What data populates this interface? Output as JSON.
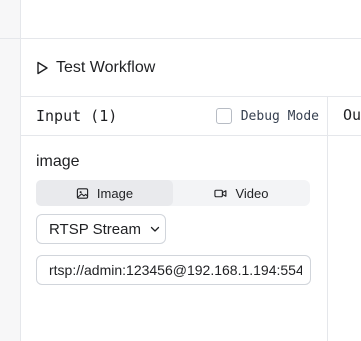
{
  "header": {
    "test_workflow_label": "Test Workflow"
  },
  "input_panel": {
    "title": "Input (1)",
    "debug_mode_label": "Debug Mode",
    "debug_mode_checked": false,
    "field": {
      "label": "image",
      "tabs": [
        {
          "label": "Image",
          "icon": "image-icon",
          "active": true
        },
        {
          "label": "Video",
          "icon": "video-icon",
          "active": false
        }
      ],
      "source_select": {
        "value": "RTSP Stream",
        "icon": "chevron-down-icon"
      },
      "url_value": "rtsp://admin:123456@192.168.1.194:554"
    }
  },
  "output_panel": {
    "title": "Ou"
  },
  "colors": {
    "border": "#e5e7eb",
    "text": "#1f2023",
    "segment_bg": "#f3f4f6"
  }
}
